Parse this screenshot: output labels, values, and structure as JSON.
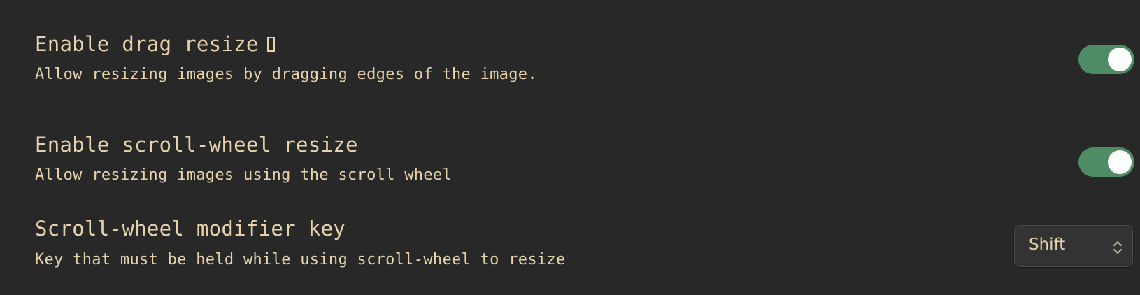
{
  "colors": {
    "background": "#282828",
    "text": "#e6d3ad",
    "toggle_on": "#4e8c66",
    "toggle_knob": "#ffffff",
    "select_bg": "#333333"
  },
  "settings": [
    {
      "name": "Enable drag resize",
      "name_glyph": "missing-glyph-box",
      "description": "Allow resizing images by dragging edges of the image.",
      "control": "toggle",
      "enabled": true
    },
    {
      "name": "Enable scroll-wheel resize",
      "description": "Allow resizing images using the scroll wheel",
      "control": "toggle",
      "enabled": true
    },
    {
      "name": "Scroll-wheel modifier key",
      "description": "Key that must be held while using scroll-wheel to resize",
      "control": "dropdown",
      "selected": "Shift",
      "icon": "chevron-up-down-icon"
    }
  ]
}
